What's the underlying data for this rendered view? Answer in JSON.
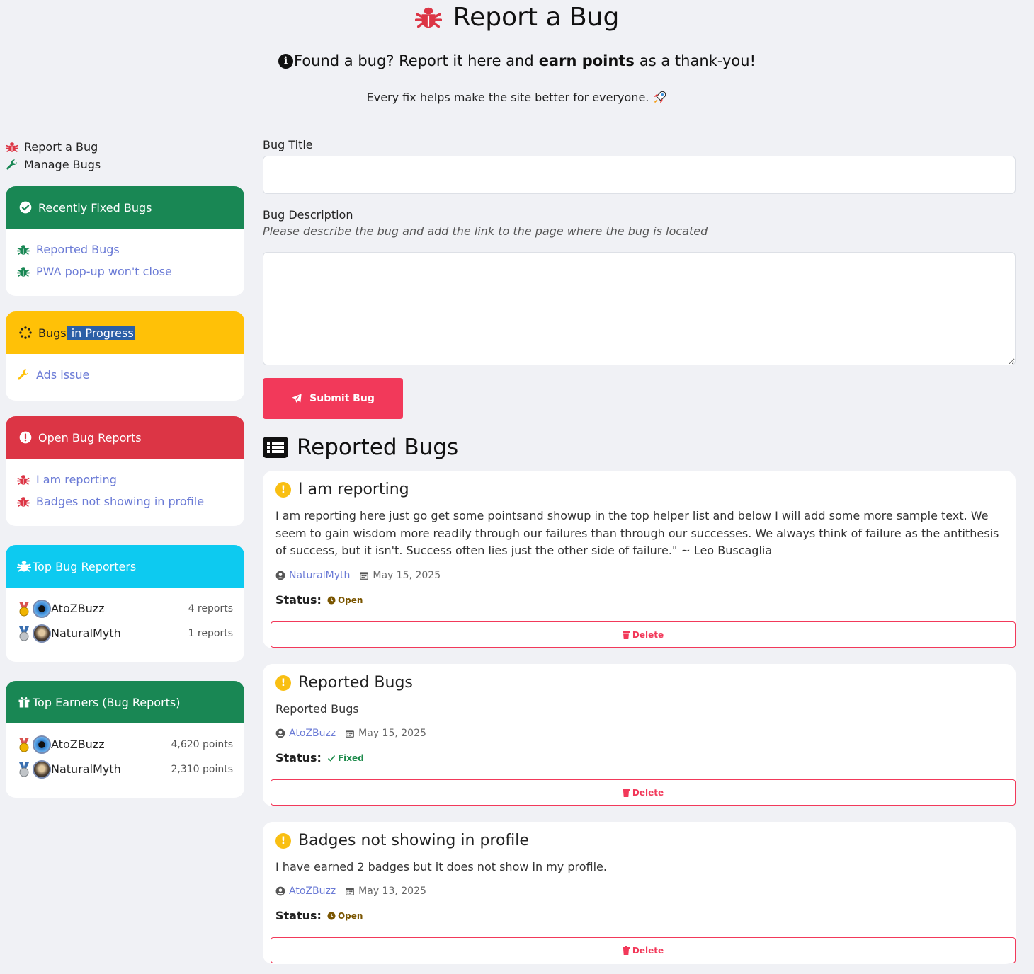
{
  "header": {
    "title": "Report a Bug",
    "intro_before": "Found a bug? Report it here and",
    "intro_bold": "earn points",
    "intro_after": "as a thank-you!",
    "subintro": "Every fix helps make the site better for everyone."
  },
  "nav": {
    "report_label": "Report a Bug",
    "manage_label": "Manage Bugs"
  },
  "fixed_card": {
    "title": "Recently Fixed Bugs",
    "color": "#198754",
    "items": [
      "Reported Bugs",
      "PWA pop-up won't close"
    ]
  },
  "progress_card": {
    "title_plain": "Bugs",
    "title_selected": " in Progress",
    "color": "#ffc107",
    "items": [
      "Ads issue"
    ]
  },
  "open_card": {
    "title": "Open Bug Reports",
    "color": "#dc3545",
    "items": [
      "I am reporting",
      "Badges not showing in profile"
    ]
  },
  "reporters_card": {
    "title": "Top Bug Reporters",
    "color": "#0dcaf0",
    "rows": [
      {
        "name": "AtoZBuzz",
        "count": "4 reports"
      },
      {
        "name": "NaturalMyth",
        "count": "1 reports"
      }
    ]
  },
  "earners_card": {
    "title": "Top Earners (Bug Reports)",
    "color": "#198754",
    "rows": [
      {
        "name": "AtoZBuzz",
        "count": "4,620 points"
      },
      {
        "name": "NaturalMyth",
        "count": "2,310 points"
      }
    ]
  },
  "form": {
    "title_label": "Bug Title",
    "title_value": "",
    "desc_label": "Bug Description",
    "desc_hint": "Please describe the bug and add the link to the page where the bug is located",
    "desc_value": "",
    "submit_label": "Submit Bug"
  },
  "reported": {
    "heading": "Reported Bugs",
    "status_label": "Status:",
    "delete_label": "Delete",
    "bugs": [
      {
        "title": "I am reporting",
        "description": "I am reporting here just go get some pointsand showup in the top helper list and below I will add some more sample text. We seem to gain wisdom more readily through our failures than through our successes. We always think of failure as the antithesis of success, but it isn't. Success often lies just the other side of failure.\" ~ Leo Buscaglia",
        "author": "NaturalMyth",
        "date": "May 15, 2025",
        "status": "Open"
      },
      {
        "title": "Reported Bugs",
        "description": "Reported Bugs",
        "author": "AtoZBuzz",
        "date": "May 15, 2025",
        "status": "Fixed"
      },
      {
        "title": "Badges not showing in profile",
        "description": "I have earned 2 badges but it does not show in my profile.",
        "author": "AtoZBuzz",
        "date": "May 13, 2025",
        "status": "Open"
      }
    ]
  },
  "colors": {
    "accent_red": "#f2395a",
    "link_blue": "#6b7bd6",
    "warning_yellow": "#f9bf12"
  }
}
